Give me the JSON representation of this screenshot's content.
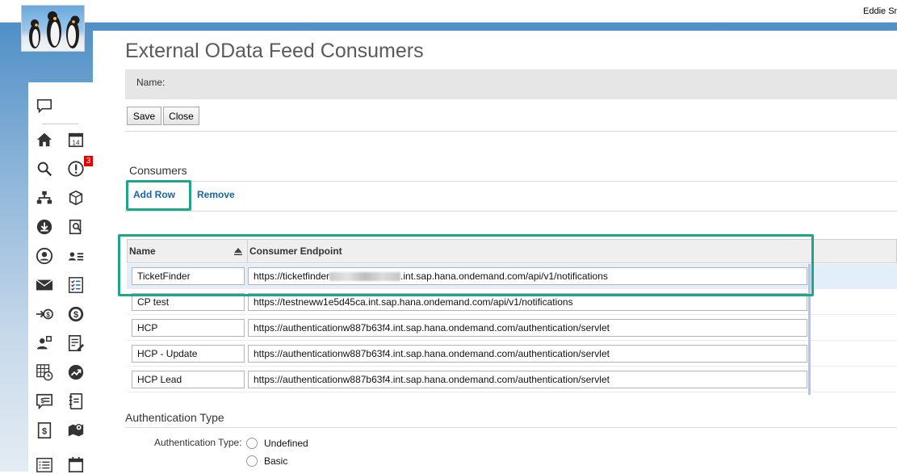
{
  "header": {
    "user_name": "Eddie Sm"
  },
  "page": {
    "title": "External OData Feed Consumers",
    "name_label": "Name:",
    "save_label": "Save",
    "close_label": "Close"
  },
  "consumers": {
    "section_title": "Consumers",
    "add_row_label": "Add Row",
    "remove_label": "Remove",
    "columns": [
      "Name",
      "Consumer Endpoint"
    ],
    "rows": [
      {
        "name": "TicketFinder",
        "endpoint_prefix": "https://ticketfinder",
        "endpoint_suffix": ".int.sap.hana.ondemand.com/api/v1/notifications"
      },
      {
        "name": "CP test",
        "endpoint": "https://testneww1e5d45ca.int.sap.hana.ondemand.com/api/v1/notifications"
      },
      {
        "name": "HCP",
        "endpoint": "https://authenticationw887b63f4.int.sap.hana.ondemand.com/authentication/servlet"
      },
      {
        "name": "HCP - Update",
        "endpoint": "https://authenticationw887b63f4.int.sap.hana.ondemand.com/authentication/servlet"
      },
      {
        "name": "HCP Lead",
        "endpoint": "https://authenticationw887b63f4.int.sap.hana.ondemand.com/authentication/servlet"
      }
    ]
  },
  "authentication": {
    "section_title": "Authentication Type",
    "field_label": "Authentication Type:",
    "options": [
      "Undefined",
      "Basic"
    ]
  },
  "sidebar": {
    "notification_count": "3",
    "icons": [
      "chat-icon",
      "home-icon",
      "calendar-icon",
      "search-icon",
      "alert-icon",
      "org-chart-icon",
      "package-icon",
      "download-icon",
      "report-search-icon",
      "person-icon",
      "contact-list-icon",
      "mail-icon",
      "checklist-icon",
      "transfer-money-icon",
      "dollar-circle-icon",
      "user-settings-icon",
      "edit-document-icon",
      "schedule-grid-icon",
      "growth-icon",
      "quote-icon",
      "notebook-icon",
      "invoice-icon",
      "map-pin-icon",
      "list-icon",
      "calendar-small-icon"
    ]
  },
  "colors": {
    "highlight": "#1fa58a",
    "link": "#1565a8",
    "badge": "#e00000"
  }
}
